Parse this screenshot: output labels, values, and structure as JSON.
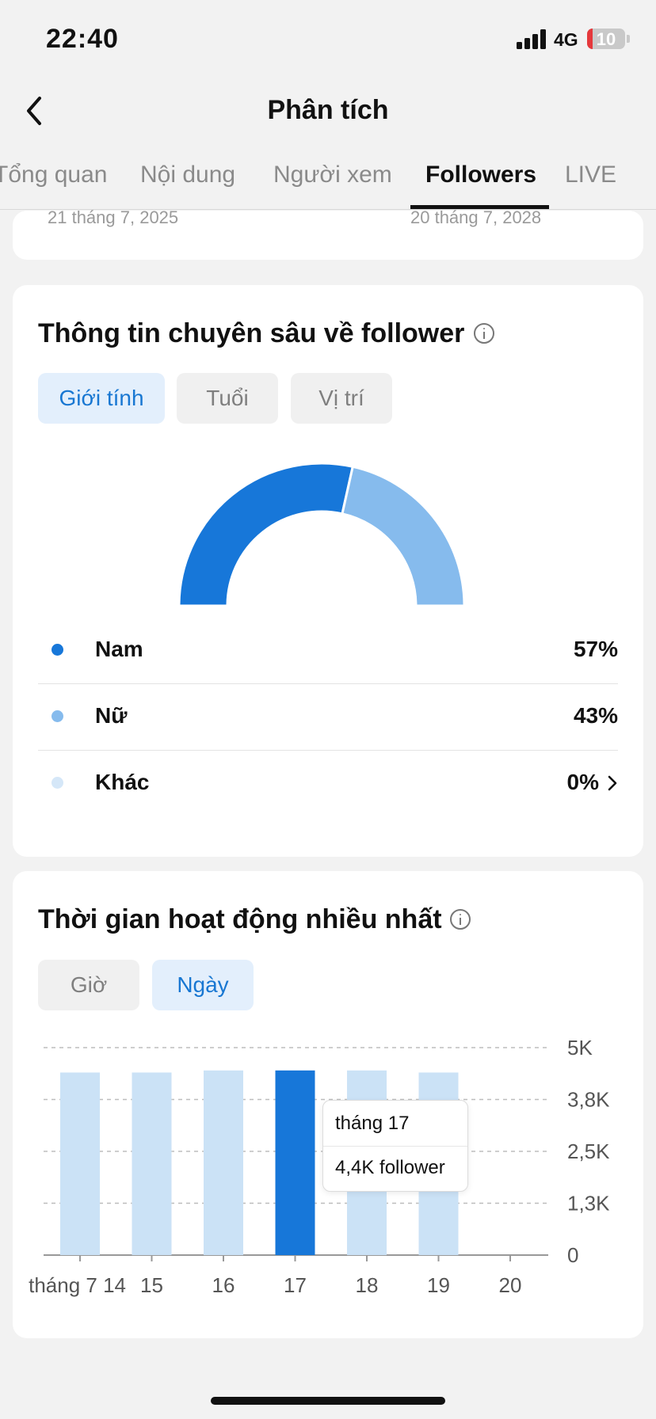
{
  "status": {
    "time": "22:40",
    "network": "4G",
    "battery": "10"
  },
  "header": {
    "title": "Phân tích"
  },
  "tabs": [
    {
      "label": "Tổng quan"
    },
    {
      "label": "Nội dung"
    },
    {
      "label": "Người xem"
    },
    {
      "label": "Followers",
      "active": true
    },
    {
      "label": "LIVE"
    }
  ],
  "date_range": {
    "start": "21 tháng 7, 2025",
    "end": "20 tháng 7, 2028"
  },
  "insights": {
    "title": "Thông tin chuyên sâu về follower",
    "filters": [
      "Giới tính",
      "Tuổi",
      "Vị trí"
    ],
    "selected_filter": "Giới tính",
    "gender": [
      {
        "label": "Nam",
        "value": "57%",
        "color": "#1777d9"
      },
      {
        "label": "Nữ",
        "value": "43%",
        "color": "#86bbed"
      },
      {
        "label": "Khác",
        "value": "0%",
        "color": "#d5e7f8"
      }
    ]
  },
  "activity": {
    "title": "Thời gian hoạt động nhiều nhất",
    "filters": [
      "Giờ",
      "Ngày"
    ],
    "selected_filter": "Ngày",
    "tooltip": {
      "title": "tháng 17",
      "value": "4,4K follower"
    }
  },
  "chart_data": [
    {
      "type": "pie",
      "variant": "half-donut",
      "categories": [
        "Nam",
        "Nữ",
        "Khác"
      ],
      "values": [
        57,
        43,
        0
      ],
      "colors": [
        "#1777d9",
        "#86bbed",
        "#d5e7f8"
      ]
    },
    {
      "type": "bar",
      "categories": [
        "tháng 7 14",
        "15",
        "16",
        "17",
        "18",
        "19",
        "20"
      ],
      "values": [
        4400,
        4400,
        4450,
        4450,
        4450,
        4400,
        0
      ],
      "highlighted_category": "17",
      "y_ticks": [
        "0",
        "1,3K",
        "2,5K",
        "3,8K",
        "5K"
      ],
      "ylim": [
        0,
        5000
      ],
      "grid": true,
      "colors": {
        "bar": "#cbe2f6",
        "highlight": "#1777d9"
      }
    }
  ]
}
